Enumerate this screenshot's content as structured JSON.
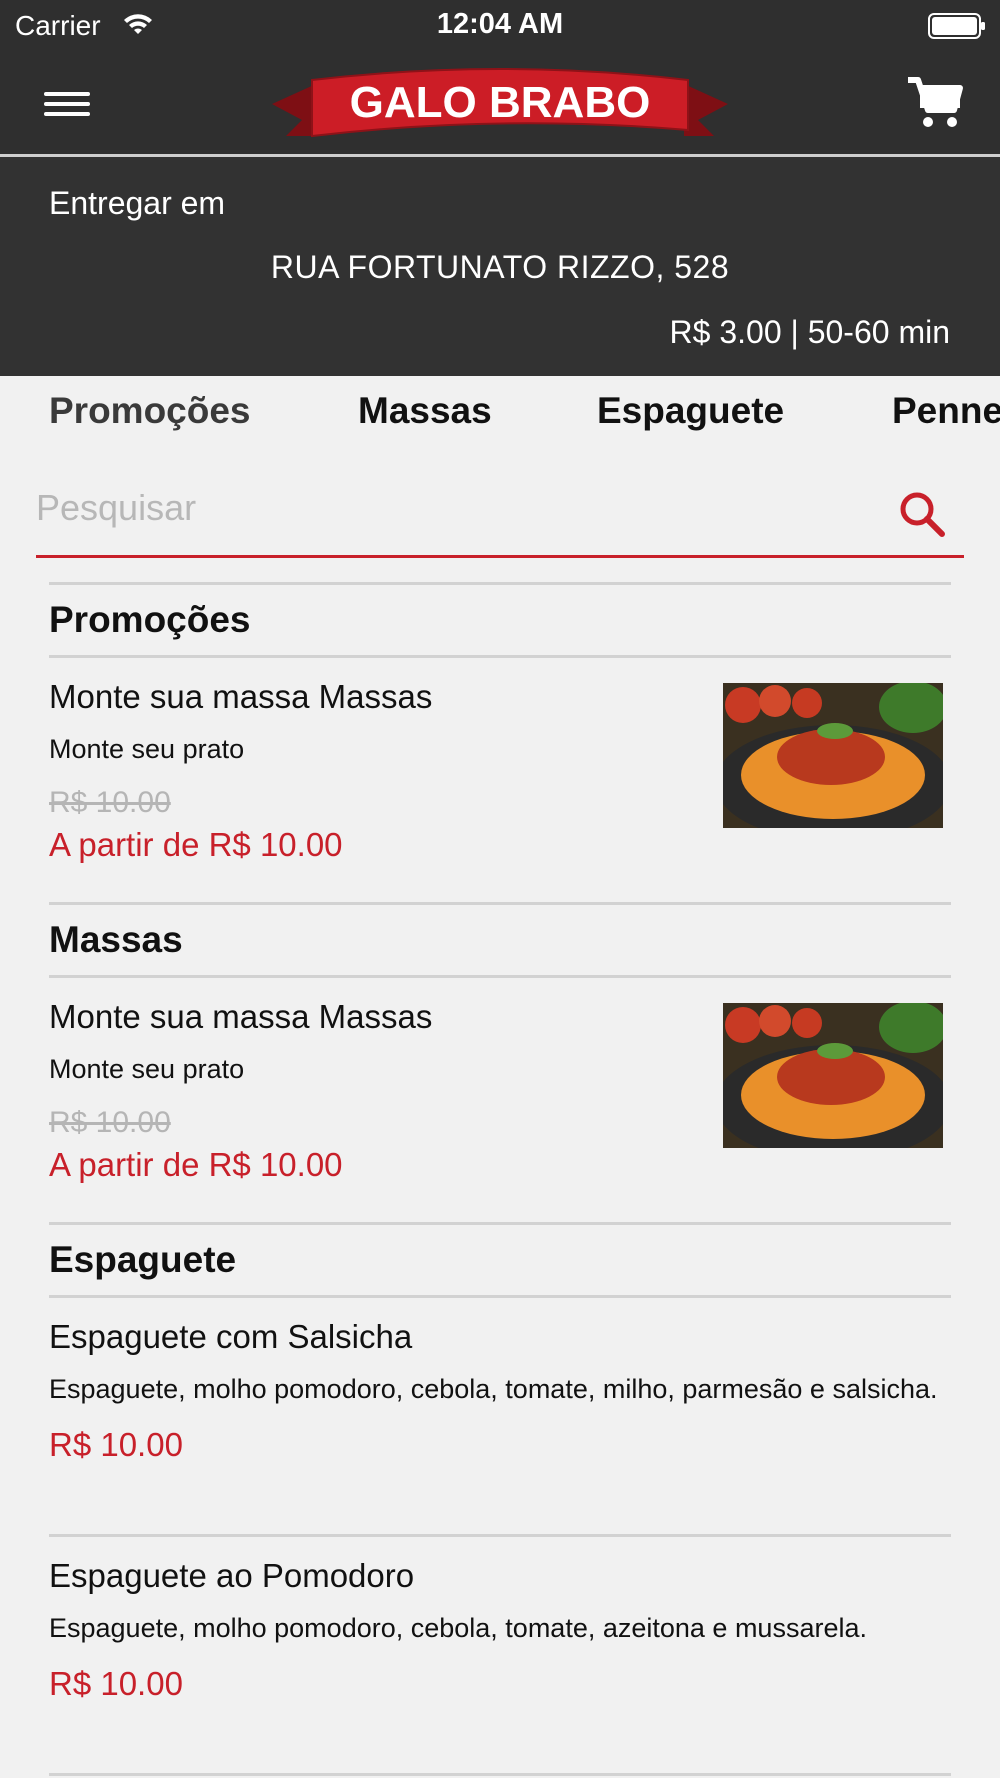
{
  "status_bar": {
    "carrier": "Carrier",
    "time": "12:04 AM"
  },
  "header": {
    "brand": "GALO BRABO"
  },
  "delivery": {
    "label": "Entregar em",
    "address": "RUA FORTUNATO RIZZO, 528",
    "fee_time": "R$ 3.00 | 50-60 min"
  },
  "tabs": [
    "Promoções",
    "Massas",
    "Espaguete",
    "Penne"
  ],
  "search": {
    "placeholder": "Pesquisar"
  },
  "sections": [
    {
      "title": "Promoções",
      "items": [
        {
          "name": "Monte sua massa Massas",
          "description": "Monte seu prato",
          "old_price": "R$ 10.00",
          "price": "A partir de R$ 10.00"
        }
      ]
    },
    {
      "title": "Massas",
      "items": [
        {
          "name": "Monte sua massa Massas",
          "description": "Monte seu prato",
          "old_price": "R$ 10.00",
          "price": "A partir de R$ 10.00"
        }
      ]
    },
    {
      "title": "Espaguete",
      "items": [
        {
          "name": "Espaguete com Salsicha",
          "description": "Espaguete, molho pomodoro, cebola, tomate, milho, parmesão e salsicha.",
          "price": "R$ 10.00"
        },
        {
          "name": "Espaguete ao Pomodoro",
          "description": "Espaguete, molho pomodoro, cebola, tomate, azeitona e mussarela.",
          "price": "R$ 10.00"
        }
      ]
    }
  ],
  "colors": {
    "bar": "#2f2f2f",
    "accent": "#c8202a",
    "background": "#f1f1f1"
  },
  "icons": [
    "wifi-icon",
    "battery-icon",
    "menu-icon",
    "cart-icon",
    "search-icon"
  ]
}
